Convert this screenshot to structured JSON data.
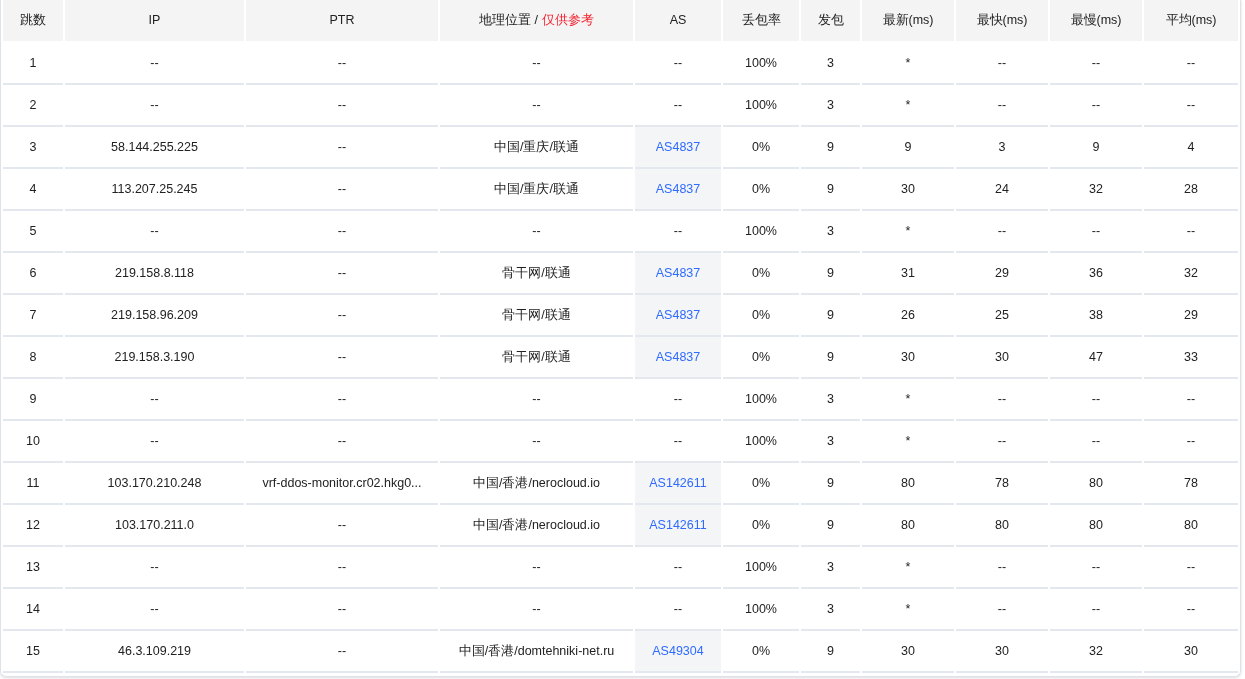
{
  "table": {
    "columns": [
      {
        "label": "跳数"
      },
      {
        "label": "IP"
      },
      {
        "label": "PTR"
      },
      {
        "label": "地理位置 /",
        "note": "仅供参考"
      },
      {
        "label": "AS"
      },
      {
        "label": "丢包率"
      },
      {
        "label": "发包"
      },
      {
        "label": "最新(ms)"
      },
      {
        "label": "最快(ms)"
      },
      {
        "label": "最慢(ms)"
      },
      {
        "label": "平均(ms)"
      }
    ],
    "rows": [
      {
        "hop": "1",
        "ip": "--",
        "ptr": "--",
        "geo": "--",
        "as": "--",
        "as_linked": false,
        "loss": "100%",
        "sent": "3",
        "last": "*",
        "best": "--",
        "worst": "--",
        "avg": "--"
      },
      {
        "hop": "2",
        "ip": "--",
        "ptr": "--",
        "geo": "--",
        "as": "--",
        "as_linked": false,
        "loss": "100%",
        "sent": "3",
        "last": "*",
        "best": "--",
        "worst": "--",
        "avg": "--"
      },
      {
        "hop": "3",
        "ip": "58.144.255.225",
        "ptr": "--",
        "geo": "中国/重庆/联通",
        "as": "AS4837",
        "as_linked": true,
        "loss": "0%",
        "sent": "9",
        "last": "9",
        "best": "3",
        "worst": "9",
        "avg": "4"
      },
      {
        "hop": "4",
        "ip": "113.207.25.245",
        "ptr": "--",
        "geo": "中国/重庆/联通",
        "as": "AS4837",
        "as_linked": true,
        "loss": "0%",
        "sent": "9",
        "last": "30",
        "best": "24",
        "worst": "32",
        "avg": "28"
      },
      {
        "hop": "5",
        "ip": "--",
        "ptr": "--",
        "geo": "--",
        "as": "--",
        "as_linked": false,
        "loss": "100%",
        "sent": "3",
        "last": "*",
        "best": "--",
        "worst": "--",
        "avg": "--"
      },
      {
        "hop": "6",
        "ip": "219.158.8.118",
        "ptr": "--",
        "geo": "骨干网/联通",
        "as": "AS4837",
        "as_linked": true,
        "loss": "0%",
        "sent": "9",
        "last": "31",
        "best": "29",
        "worst": "36",
        "avg": "32"
      },
      {
        "hop": "7",
        "ip": "219.158.96.209",
        "ptr": "--",
        "geo": "骨干网/联通",
        "as": "AS4837",
        "as_linked": true,
        "loss": "0%",
        "sent": "9",
        "last": "26",
        "best": "25",
        "worst": "38",
        "avg": "29"
      },
      {
        "hop": "8",
        "ip": "219.158.3.190",
        "ptr": "--",
        "geo": "骨干网/联通",
        "as": "AS4837",
        "as_linked": true,
        "loss": "0%",
        "sent": "9",
        "last": "30",
        "best": "30",
        "worst": "47",
        "avg": "33"
      },
      {
        "hop": "9",
        "ip": "--",
        "ptr": "--",
        "geo": "--",
        "as": "--",
        "as_linked": false,
        "loss": "100%",
        "sent": "3",
        "last": "*",
        "best": "--",
        "worst": "--",
        "avg": "--"
      },
      {
        "hop": "10",
        "ip": "--",
        "ptr": "--",
        "geo": "--",
        "as": "--",
        "as_linked": false,
        "loss": "100%",
        "sent": "3",
        "last": "*",
        "best": "--",
        "worst": "--",
        "avg": "--"
      },
      {
        "hop": "11",
        "ip": "103.170.210.248",
        "ptr": "vrf-ddos-monitor.cr02.hkg0...",
        "geo": "中国/香港/nerocloud.io",
        "as": "AS142611",
        "as_linked": true,
        "loss": "0%",
        "sent": "9",
        "last": "80",
        "best": "78",
        "worst": "80",
        "avg": "78"
      },
      {
        "hop": "12",
        "ip": "103.170.211.0",
        "ptr": "--",
        "geo": "中国/香港/nerocloud.io",
        "as": "AS142611",
        "as_linked": true,
        "loss": "0%",
        "sent": "9",
        "last": "80",
        "best": "80",
        "worst": "80",
        "avg": "80"
      },
      {
        "hop": "13",
        "ip": "--",
        "ptr": "--",
        "geo": "--",
        "as": "--",
        "as_linked": false,
        "loss": "100%",
        "sent": "3",
        "last": "*",
        "best": "--",
        "worst": "--",
        "avg": "--"
      },
      {
        "hop": "14",
        "ip": "--",
        "ptr": "--",
        "geo": "--",
        "as": "--",
        "as_linked": false,
        "loss": "100%",
        "sent": "3",
        "last": "*",
        "best": "--",
        "worst": "--",
        "avg": "--"
      },
      {
        "hop": "15",
        "ip": "46.3.109.219",
        "ptr": "--",
        "geo": "中国/香港/domtehniki-net.ru",
        "as": "AS49304",
        "as_linked": true,
        "loss": "0%",
        "sent": "9",
        "last": "30",
        "best": "30",
        "worst": "32",
        "avg": "30"
      }
    ]
  }
}
